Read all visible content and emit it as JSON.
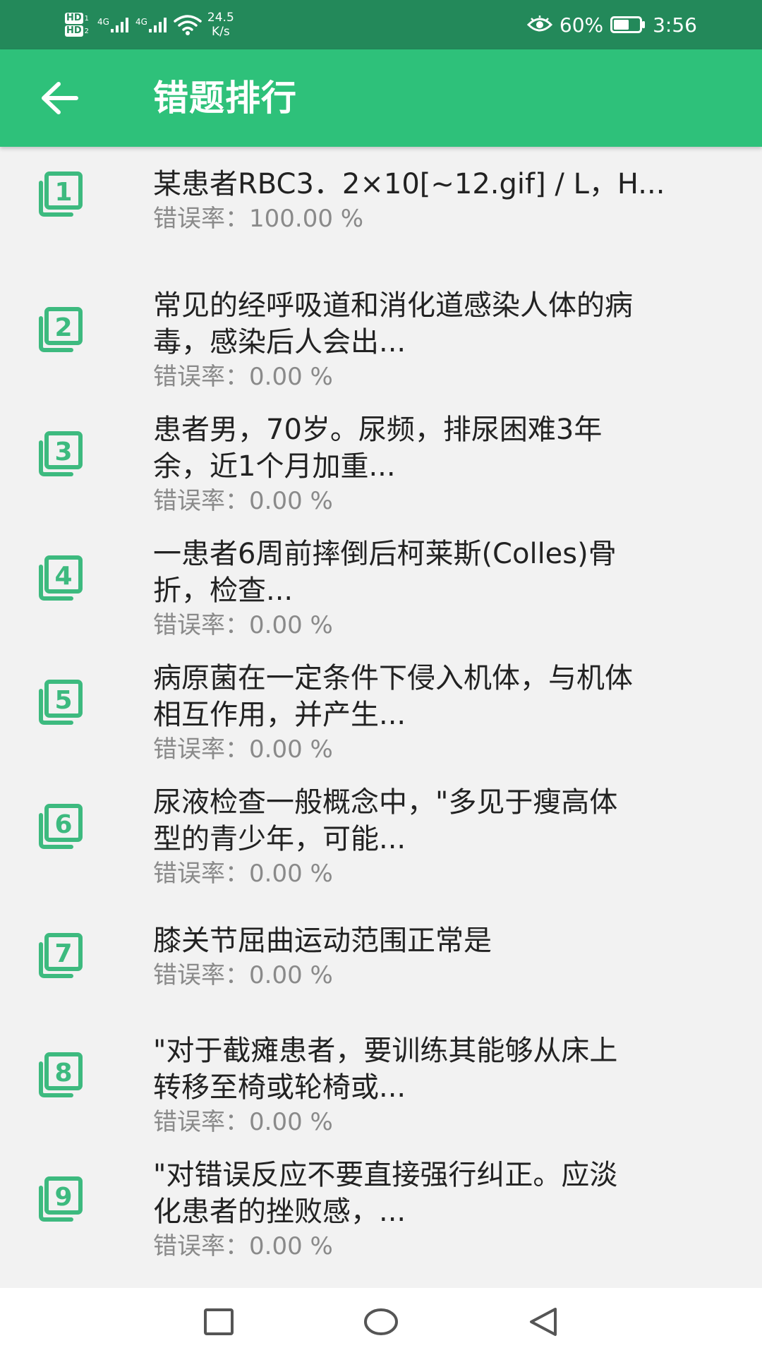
{
  "status_bar": {
    "hd1": "HD",
    "hd1_sub": "1",
    "hd2": "HD",
    "hd2_sub": "2",
    "sim1_label": "4G",
    "sim2_label": "4G",
    "net_speed": "24.5",
    "net_unit": "K/s",
    "battery_percent": "60%",
    "time": "3:56",
    "battery_level": 0.6
  },
  "app_bar": {
    "title": "错题排行"
  },
  "rate_label": "错误率：",
  "items": [
    {
      "rank": "1",
      "question": "某患者RBC3．2×10[~12.gif] / L，H...",
      "rate": "100.00 %"
    },
    {
      "rank": "2",
      "question": "常见的经呼吸道和消化道感染人体的病\n毒，感染后人会出...",
      "rate": "0.00 %"
    },
    {
      "rank": "3",
      "question": "患者男，70岁。尿频，排尿困难3年\n余，近1个月加重...",
      "rate": "0.00 %"
    },
    {
      "rank": "4",
      "question": "一患者6周前摔倒后柯莱斯(Colles)骨\n折，检查...",
      "rate": "0.00 %"
    },
    {
      "rank": "5",
      "question": "病原菌在一定条件下侵入机体，与机体\n相互作用，并产生...",
      "rate": "0.00 %"
    },
    {
      "rank": "6",
      "question": "尿液检查一般概念中，\"多见于瘦高体\n型的青少年，可能...",
      "rate": "0.00 %"
    },
    {
      "rank": "7",
      "question": "膝关节屈曲运动范围正常是",
      "rate": "0.00 %"
    },
    {
      "rank": "8",
      "question": "\"对于截瘫患者，要训练其能够从床上\n转移至椅或轮椅或...",
      "rate": "0.00 %"
    },
    {
      "rank": "9",
      "question": "\"对错误反应不要直接强行纠正。应淡\n化患者的挫败感，...",
      "rate": "0.00 %"
    }
  ],
  "colors": {
    "status_bar": "#23895a",
    "app_bar": "#2ec17a",
    "icon_green": "#3dba7f",
    "background": "#f2f2f2"
  },
  "icons": {
    "back": "arrow-left-icon",
    "rank": "filter-number-icon",
    "nav_recent": "square-icon",
    "nav_home": "circle-icon",
    "nav_back": "triangle-back-icon"
  }
}
